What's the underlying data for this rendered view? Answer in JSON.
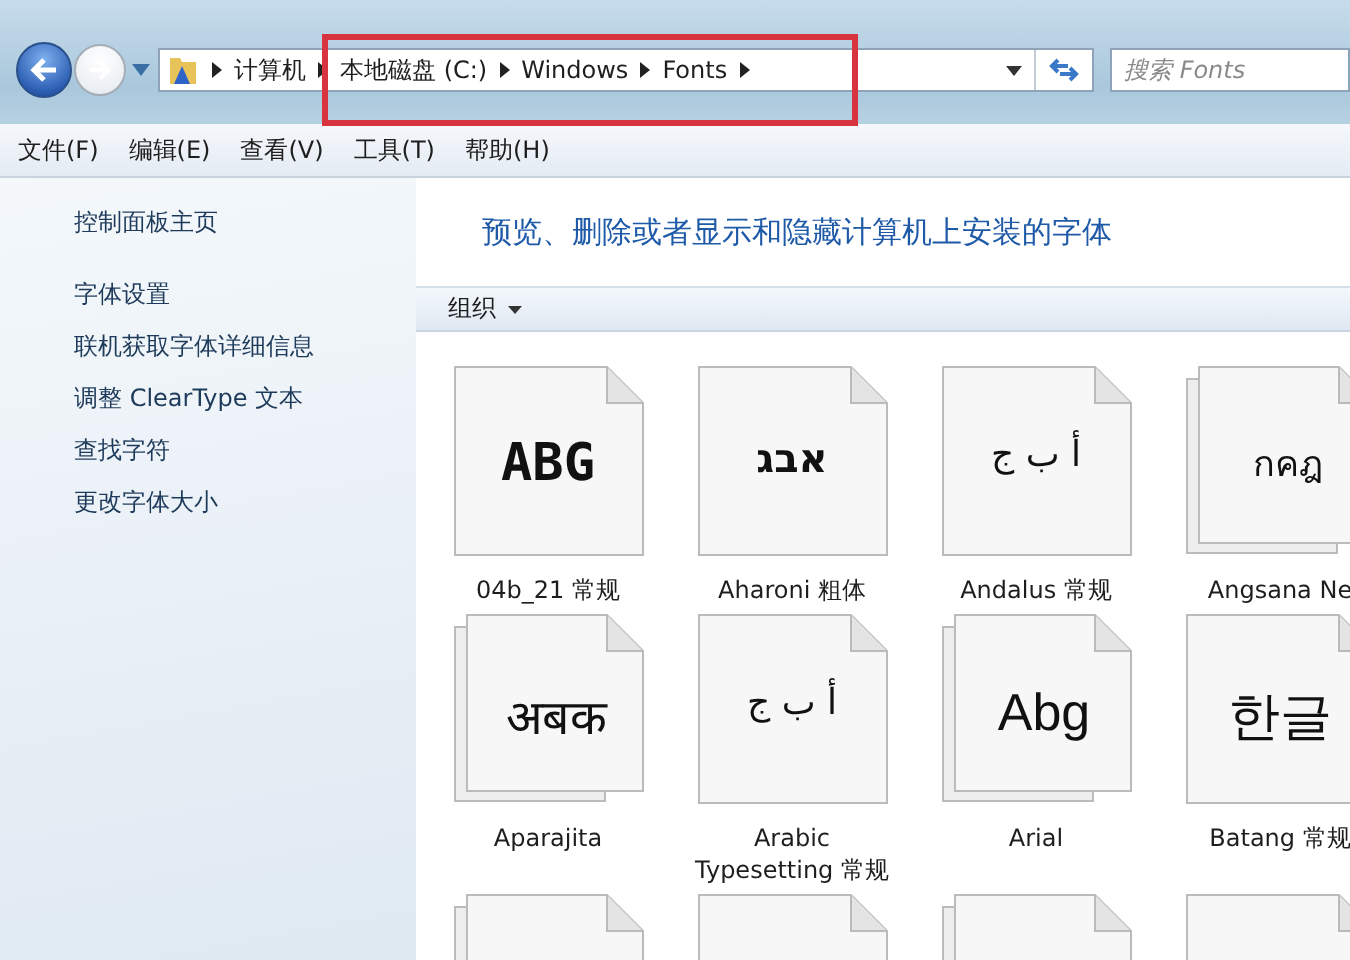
{
  "navigation": {
    "back_enabled": true,
    "forward_enabled": false,
    "breadcrumbs": [
      "计算机",
      "本地磁盘 (C:)",
      "Windows",
      "Fonts"
    ],
    "search": {
      "placeholder": "搜索 Fonts"
    }
  },
  "menu_bar": [
    "文件(F)",
    "编辑(E)",
    "查看(V)",
    "工具(T)",
    "帮助(H)"
  ],
  "sidebar": {
    "home_link": "控制面板主页",
    "links": [
      "字体设置",
      "联机获取字体详细信息",
      "调整 ClearType 文本",
      "查找字符",
      "更改字体大小"
    ]
  },
  "content": {
    "title": "预览、删除或者显示和隐藏计算机上安装的字体",
    "toolbar": {
      "organize": "组织"
    },
    "fonts": [
      {
        "name": "04b_21 常规",
        "sample": "ABG",
        "kind": "pixel",
        "stacked": false
      },
      {
        "name": "Aharoni 粗体",
        "sample": "אבג",
        "kind": "hebrew",
        "stacked": false
      },
      {
        "name": "Andalus 常规",
        "sample": "أ ب ج",
        "kind": "arabic",
        "stacked": false
      },
      {
        "name": "Angsana Ne",
        "sample": "กคฎ",
        "kind": "thai",
        "stacked": true
      },
      {
        "name": "Aparajita",
        "sample": "अबक",
        "kind": "devanagari",
        "stacked": true
      },
      {
        "name": "Arabic Typesetting 常规",
        "sample": "أ ب ج",
        "kind": "arabic",
        "stacked": false
      },
      {
        "name": "Arial",
        "sample": "Abg",
        "kind": "latin",
        "stacked": true
      },
      {
        "name": "Batang 常规",
        "sample": "한글",
        "kind": "korean",
        "stacked": false
      },
      {
        "stacked": true
      },
      {
        "stacked": false
      },
      {
        "stacked": true
      },
      {
        "stacked": false
      }
    ]
  },
  "annotation": {
    "highlight": true
  }
}
